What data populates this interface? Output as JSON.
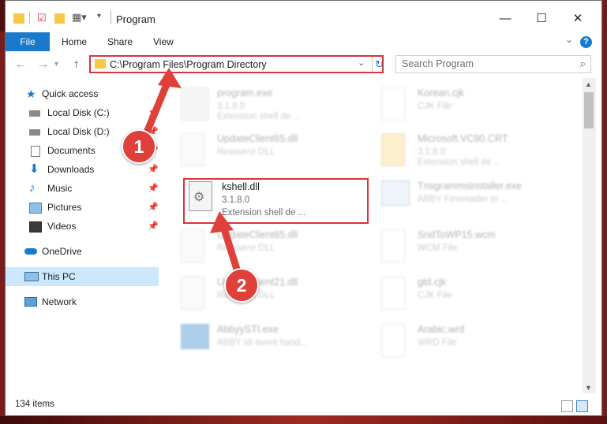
{
  "window": {
    "title": "Program"
  },
  "ribbon": {
    "tabs": [
      "File",
      "Home",
      "Share",
      "View"
    ],
    "help_label": "?"
  },
  "address": {
    "path": "C:\\Program Files\\Program Directory"
  },
  "search": {
    "placeholder": "Search Program"
  },
  "sidebar": {
    "items": [
      {
        "label": "Quick access",
        "icon": "star-icon"
      },
      {
        "label": "Local Disk (C:)",
        "icon": "drive-icon"
      },
      {
        "label": "Local Disk (D:)",
        "icon": "drive-icon"
      },
      {
        "label": "Documents",
        "icon": "document-icon"
      },
      {
        "label": "Downloads",
        "icon": "download-icon"
      },
      {
        "label": "Music",
        "icon": "music-icon"
      },
      {
        "label": "Pictures",
        "icon": "picture-icon"
      },
      {
        "label": "Videos",
        "icon": "video-icon"
      },
      {
        "label": "OneDrive",
        "icon": "cloud-icon"
      },
      {
        "label": "This PC",
        "icon": "computer-icon"
      },
      {
        "label": "Network",
        "icon": "network-icon"
      }
    ]
  },
  "files": [
    {
      "name": "program.exe",
      "line2": "3.1.8.0",
      "line3": "Extension shell de ..."
    },
    {
      "name": "Korean.cjk",
      "line2": "CJK File",
      "line3": ""
    },
    {
      "name": "UpdateClient65.dll",
      "line2": "Resource DLL",
      "line3": ""
    },
    {
      "name": "Microsoft.VC90.CRT",
      "line2": "3.1.8.0",
      "line3": "Extension shell de ..."
    },
    {
      "name": "kshell.dll",
      "line2": "3.1.8.0",
      "line3": "Extension shell de ..."
    },
    {
      "name": "Tnsgrammsinstaller.exe",
      "line2": "ABBY Finereader to ...",
      "line3": ""
    },
    {
      "name": "UpdateClient65.dll",
      "line2": "Resource DLL",
      "line3": ""
    },
    {
      "name": "SndToWP15.wcm",
      "line2": "WCM File",
      "line3": ""
    },
    {
      "name": "UpdateClient21.dll",
      "line2": "Resource DLL",
      "line3": ""
    },
    {
      "name": "gtd.cjk",
      "line2": "CJK File",
      "line3": ""
    },
    {
      "name": "AbbyySTI.exe",
      "line2": "ABBY sti event hand...",
      "line3": ""
    },
    {
      "name": "Arabic.wrd",
      "line2": "WRD File",
      "line3": ""
    }
  ],
  "status": {
    "item_count": "134 items"
  },
  "annotations": {
    "step1": "1",
    "step2": "2"
  },
  "colors": {
    "accent": "#1979ca",
    "highlight": "#d9343a",
    "selected": "#cce8ff"
  }
}
